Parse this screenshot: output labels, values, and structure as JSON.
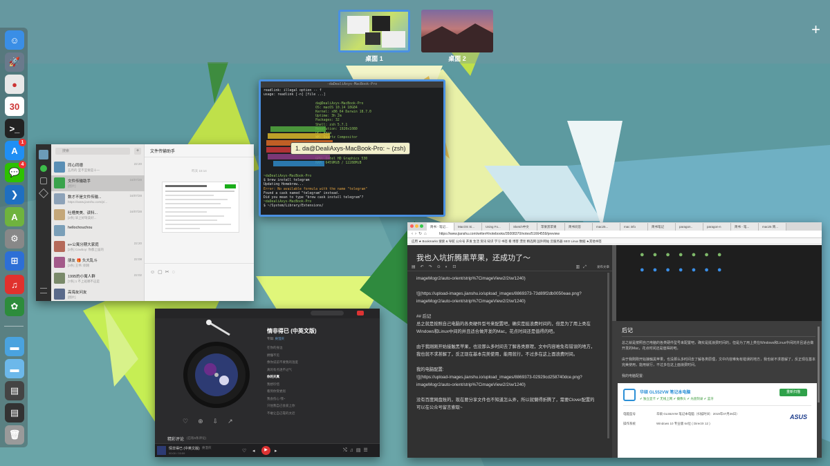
{
  "spaces": {
    "items": [
      {
        "label": "桌面 1"
      },
      {
        "label": "桌面 2"
      }
    ],
    "add_label": "+"
  },
  "dock": {
    "items": [
      {
        "name": "finder-icon",
        "color": "#3a8ee6",
        "glyph": "☺"
      },
      {
        "name": "launchpad-icon",
        "color": "#6a7a8c",
        "glyph": "🚀"
      },
      {
        "name": "chrome-icon",
        "color": "#e8e8e8",
        "glyph": "●"
      },
      {
        "name": "calendar-icon",
        "color": "#ffffff",
        "glyph": "30",
        "top": "JUL"
      },
      {
        "name": "terminal-icon",
        "color": "#222222",
        "glyph": ">_"
      },
      {
        "name": "appstore-icon",
        "color": "#1f8ff5",
        "glyph": "A",
        "badge": "1"
      },
      {
        "name": "wechat-icon",
        "color": "#2dc100",
        "glyph": "💬",
        "badge": "4"
      },
      {
        "name": "vscode-icon",
        "color": "#1f6fc1",
        "glyph": "❯"
      },
      {
        "name": "android-studio-icon",
        "color": "#6fb33e",
        "glyph": "A"
      },
      {
        "name": "system-preferences-icon",
        "color": "#888888",
        "glyph": "⚙"
      },
      {
        "name": "windows-icon",
        "color": "#2d6fd6",
        "glyph": "⊞"
      },
      {
        "name": "netease-music-icon",
        "color": "#e0312d",
        "glyph": "♫"
      },
      {
        "name": "app-icon",
        "color": "#2d8c3c",
        "glyph": "✿"
      },
      {
        "name": "folder-icon",
        "color": "#4aa3df",
        "glyph": "▬"
      },
      {
        "name": "folder-icon-2",
        "color": "#6cb8ea",
        "glyph": "▬"
      },
      {
        "name": "screenshot-icon",
        "color": "#444444",
        "glyph": "▤"
      },
      {
        "name": "screenshot-icon-2",
        "color": "#333333",
        "glyph": "▤"
      },
      {
        "name": "trash-icon",
        "color": "#9a9a9a",
        "glyph": "🗑"
      }
    ]
  },
  "wechat": {
    "search_placeholder": "搜索",
    "header": "文件传输助手",
    "date_divider": "昨天 15:14",
    "chats": [
      {
        "name": "同心同德",
        "preview": "五月的 宜不宜要是十一",
        "time": "22:20",
        "color": "#5a8fb5"
      },
      {
        "name": "文件传输助手",
        "preview": "[图片]",
        "time": "16/07/28",
        "color": "#3aa34c"
      },
      {
        "name": "数才不是文件传输...",
        "preview": "https://www.jianshu.com/p/...",
        "time": "16/07/28",
        "color": "#8da2b8"
      },
      {
        "name": "吐槽美美、读科...",
        "preview": "[2条] 早上好呀美好...",
        "time": "16/07/28",
        "color": "#c4a779"
      },
      {
        "name": "hellochouchou",
        "preview": "",
        "time": "",
        "color": "#7a9fb8"
      },
      {
        "name": "e+公寓分期大家庭",
        "preview": "[2条] Cowboy: 你都上届的",
        "time": "22:20",
        "color": "#b56a5a"
      },
      {
        "name": "朋友 🎁 头大乱斗",
        "preview": "[3条] 王伟: 刚刚",
        "time": "22:08",
        "color": "#a35a8a"
      },
      {
        "name": "1995的小寓人群",
        "preview": "[7条] 1 不上班哪不这是",
        "time": "22:02",
        "color": "#7a8a6a"
      },
      {
        "name": "高海友问友",
        "preview": "[图片]",
        "time": "",
        "color": "#5a6a8a"
      }
    ]
  },
  "terminal": {
    "title": "1. da@DealiAxys-MacBook-Pro: ~ (zsh)",
    "lines": [
      "readlink: illegal option -- f",
      "usage: readlink [-n] [file ...]",
      "",
      "                          da@DealiAxys-MacBook-Pro",
      "                          OS: macOS 10.14 18G84",
      "                          Kernel: x86_64 Darwin 18.7.0",
      "                          Uptime: 3h 2m",
      "                          Packages: 32",
      "                          Shell: zsh 5.7.1",
      "                          Resolution: 1920x1080",
      "                          DE: Aqua",
      "                          WM: Quartz Compositor",
      "",
      "",
      "",
      "",
      "                          GPU: Intel HD Graphics 530",
      "                          RAM: 6459MiB / 12288MiB",
      "",
      "",
      "~daDealiAxys-MacBook-Pro",
      "$ brew install telegram",
      "Updating Homebrew...",
      "Error: No available formula with the name \"telegram\"",
      "Found a cask named \"telegram\" instead.",
      "Did you mean to type \"brew cask install telegram\"?",
      "~daDealiAxys-MacBook-Pro",
      "$ ~/System/Library/Extensions/"
    ]
  },
  "music": {
    "song_title": "情非得已 (中英文版)",
    "artist_label": "专辑: ",
    "artist": "庾澄庆",
    "lyrics": [
      "在你的身边",
      "拥懂不见",
      "像你说前不要我的温度",
      "真的有点透不过气",
      "你的天真",
      "我想珍惜",
      "看到你受委屈",
      "我会伤心 嘿~",
      "只怕我自己会爱上你",
      "不敢让自己靠的太近"
    ],
    "comments_label": "精彩评论",
    "comments_count": "(已有6条评论)",
    "now_playing": "情非得已 (中英文版)",
    "now_artist": "庾澄庆",
    "time": "00:00 / 03:59"
  },
  "browser": {
    "tabs": [
      "简书 - 笔记...",
      "MacOS Si...",
      "Using Fo...",
      "Sketch中文",
      "苹果黑苹果",
      "简书问答",
      "mac25...",
      "mac info",
      "简书笔记",
      "paragon..",
      "paragon-n",
      "简书 - 笔...",
      "mac25 简..."
    ],
    "url": "https://www.jianshu.com/writer#/notebooks/35008370/notes/51664559/preview",
    "bookmarks": "应用  ★ Bookmarks  搜索 & 导航  公众号  开发  生活  资讯  知识  学习  书签  看  博客  漂亮  精选网  国外网站  云服务器  SEO  Linux  数据  ★其他书签",
    "doc_title": "我也入坑折腾黑苹果，还成功了～",
    "md_lines": [
      "imageMogr2/auto-orient/strip%7CimageView2/2/w/1240)",
      "",
      "![](https://upload-images.jianshu.io/upload_images/8869373-73d89f2db0050eae.png?",
      "imageMogr2/auto-orient/strip%7CimageView2/2/w/1240)",
      "",
      "## 后记",
      "总之就是按照自己电脑的各类硬件型号来配置吧，确实是挺浪费时间的，但是为了用上类在",
      "Windows和Linux中间的并且适合做开发的Mac，花点时间还是值得的吧。",
      "",
      "由于我刚刚开始接触黑苹果，也没那么多时间去了解各类原理，文中内容难免有错误的地方，",
      "我也就不求甚解了，反正现在基本完美使用，能用就行，不过多在这上面浪费时间。",
      "",
      "我的电脑配置:",
      "![](https://upload-images.jianshu.io/upload_images/8869373-02929cd258740dce.png?",
      "imageMogr2/auto-orient/strip%7CimageView2/2/w/1240)",
      "",
      "没有百度网盘账的，现在要分享文件也不知道怎么弄，所以就懒得折腾了，需要Clover配置的",
      "可以在公众号留言索取~"
    ],
    "preview_heading": "后记",
    "preview_p1": "总之就是按照自己电脑的各类硬件型号来配置吧，确实是挺浪费时间的，但是为了用上类在Windows和Linux中间的并且适合做开发的Mac，花点时间还是值得的吧。",
    "preview_p2": "由于我刚刚开始接触黑苹果，也没那么多时间去了解各类原理，文中内容难免有错误的地方，我也就不求甚解了，反正现在基本完美使用，能用就行，不过多在这上面浪费时间。",
    "preview_p3": "我的电脑配置:",
    "card_title": "华硕 GL552VW 笔记本电脑",
    "card_features": "✔ 独立显卡  ✔ 无线上网  ✔ 摄像头  ✔ 光盘刻录  ✔ 蓝牙",
    "card_button": "重新扫描",
    "spec_model_label": "电脑型号",
    "spec_model_value": "华硕 GL552VW 笔记本电脑（扫描时间：2019年07月26日）",
    "spec_os_label": "操作系统",
    "spec_os_value": "Windows 10 专业版 64位 ( DirectX 12 )",
    "card_brand": "ASUS",
    "publish_label": "发布文章"
  }
}
